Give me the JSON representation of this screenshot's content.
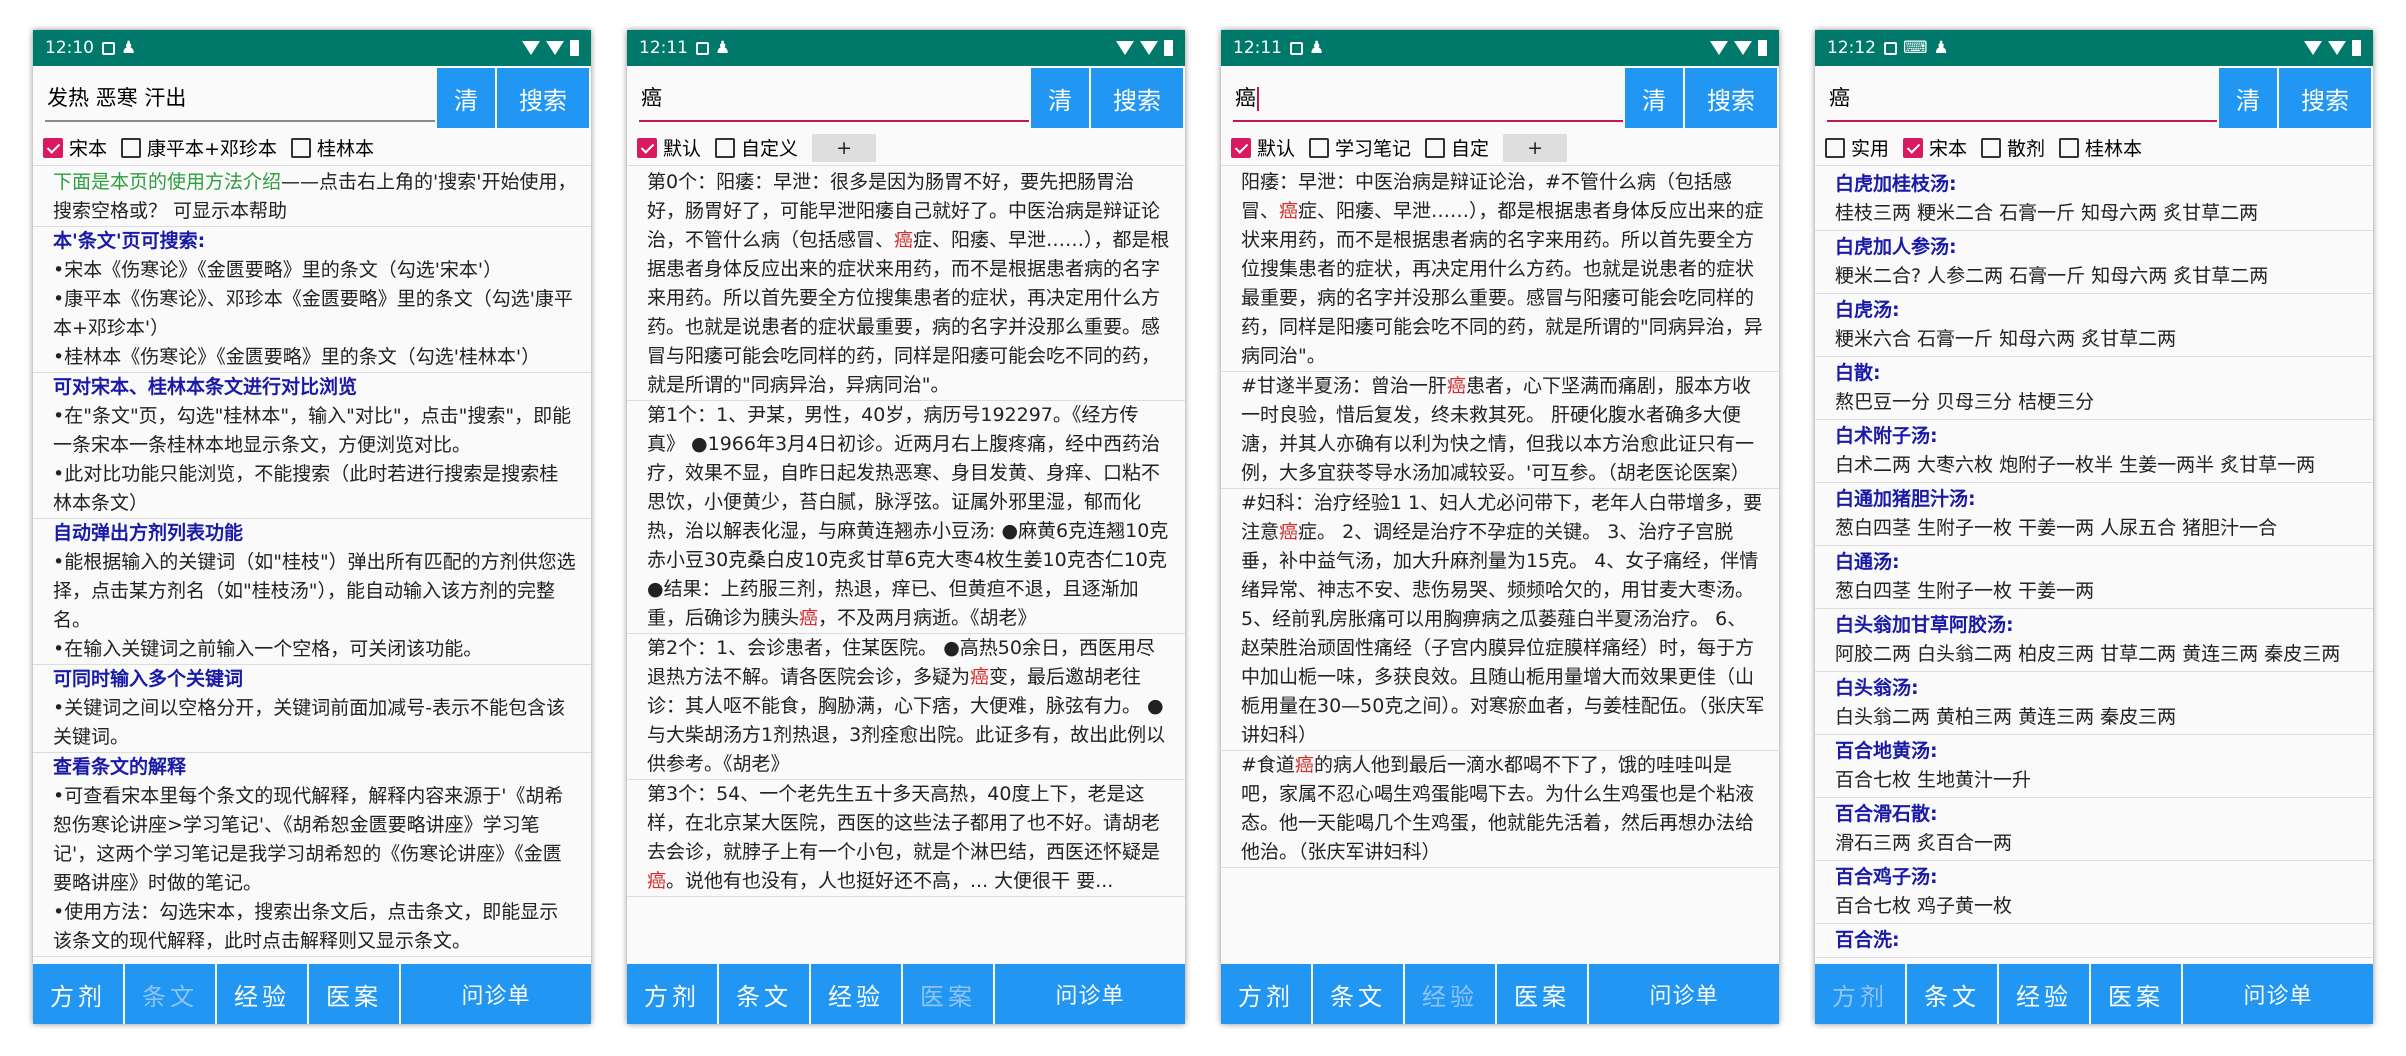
{
  "screens": [
    {
      "status_time": "12:10",
      "search_value": "发热 恶寒 汗出",
      "clear_label": "清",
      "search_label": "搜索",
      "checks": [
        {
          "label": "宋本",
          "checked": true
        },
        {
          "label": "康平本+邓珍本",
          "checked": false
        },
        {
          "label": "桂林本",
          "checked": false
        }
      ],
      "help": {
        "intro_green": "下面是本页的使用方法介绍",
        "intro_rest": "——点击右上角的'搜索'开始使用，搜索空格或？ 可显示本帮助",
        "s1_title": "本'条文'页可搜索:",
        "s1_lines": [
          "•宋本《伤寒论》《金匮要略》里的条文（勾选'宋本'）",
          "•康平本《伤寒论》、邓珍本《金匮要略》里的条文（勾选'康平本+邓珍本'）",
          "•桂林本《伤寒论》《金匮要略》里的条文（勾选'桂林本'）"
        ],
        "s2_title": "可对宋本、桂林本条文进行对比浏览",
        "s2_lines": [
          "•在\"条文\"页，勾选\"桂林本\"，输入\"对比\"，点击\"搜索\"，即能一条宋本一条桂林本地显示条文，方便浏览对比。",
          "•此对比功能只能浏览，不能搜索（此时若进行搜索是搜索桂林本条文）"
        ],
        "s3_title": "自动弹出方剂列表功能",
        "s3_lines": [
          "•能根据输入的关键词（如\"桂枝\"）弹出所有匹配的方剂供您选择，点击某方剂名（如\"桂枝汤\"），能自动输入该方剂的完整名。",
          "•在输入关键词之前输入一个空格，可关闭该功能。"
        ],
        "s4_title": "可同时输入多个关键词",
        "s4_lines": [
          "•关键词之间以空格分开，关键词前面加减号-表示不能包含该关键词。"
        ],
        "s5_title": "查看条文的解释",
        "s5_lines": [
          "•可查看宋本里每个条文的现代解释，解释内容来源于'《胡希恕伤寒论讲座>学习笔记'、《胡希恕金匮要略讲座》学习笔记'，这两个学习笔记是我学习胡希恕的《伤寒论讲座》《金匮要略讲座》时做的笔记。",
          "•使用方法：勾选宋本，搜索出条文后，点击条文，即能显示该条文的现代解释，此时点击解释则又显示条文。"
        ]
      },
      "tabs": [
        {
          "label": "方剂",
          "dim": false
        },
        {
          "label": "条文",
          "dim": true
        },
        {
          "label": "经验",
          "dim": false
        },
        {
          "label": "医案",
          "dim": false
        },
        {
          "label": "问诊单",
          "dim": false
        }
      ]
    },
    {
      "status_time": "12:11",
      "search_value": "癌",
      "clear_label": "清",
      "search_label": "搜索",
      "checks": [
        {
          "label": "默认",
          "checked": true
        },
        {
          "label": "自定义",
          "checked": false
        }
      ],
      "plus_label": "+",
      "entries": [
        [
          "第0个：阳痿：早泄：很多是因为肠胃不好，要先把肠胃治好，肠胃好了，可能早泄阳痿自己就好了。中医治病是辩证论治，不管什么病（包括感冒、",
          "癌",
          "症、阳痿、早泄……），都是根据患者身体反应出来的症状来用药，而不是根据患者病的名字来用药。所以首先要全方位搜集患者的症状，再决定用什么方药。也就是说患者的症状最重要，病的名字并没那么重要。感冒与阳痿可能会吃同样的药，同样是阳痿可能会吃不同的药，就是所谓的\"同病异治，异病同治\"。"
        ],
        [
          "第1个：1、尹某，男性，40岁，病历号192297。《经方传真》 ●1966年3月4日初诊。近两月右上腹疼痛，经中西药治疗，效果不显，自昨日起发热恶寒、身目发黄、身痒、口粘不思饮，小便黄少，苔白腻，脉浮弦。证属外邪里湿，郁而化热，治以解表化湿，与麻黄连翘赤小豆汤: ●麻黄6克连翘10克赤小豆30克桑白皮10克炙甘草6克大枣4枚生姜10克杏仁10克 ●结果：上药服三剂，热退，痒已、但黄疸不退，且逐渐加重，后确诊为胰头",
          "癌",
          "，不及两月病逝。《胡老》"
        ],
        [
          "第2个：1、会诊患者，住某医院。 ●高热50余日，西医用尽退热方法不解。请各医院会诊，多疑为",
          "癌",
          "变，最后邀胡老往诊：其人呕不能食，胸胁满，心下痞，大便难，脉弦有力。 ●与大柴胡汤方1剂热退，3剂痊愈出院。此证多有，故出此例以供参考。《胡老》"
        ],
        [
          "第3个：54、一个老先生五十多天高热，40度上下，老是这样，在北京某大医院，西医的这些法子都用了也不好。请胡老去会诊，就脖子上有一个小包，就是个淋巴结，西医还怀疑是",
          "癌",
          "。说他有也没有，人也挺好还不高，... 大便很干 要..."
        ]
      ],
      "tabs": [
        {
          "label": "方剂",
          "dim": false
        },
        {
          "label": "条文",
          "dim": false
        },
        {
          "label": "经验",
          "dim": false
        },
        {
          "label": "医案",
          "dim": true
        },
        {
          "label": "问诊单",
          "dim": false
        }
      ]
    },
    {
      "status_time": "12:11",
      "search_value": "癌",
      "clear_label": "清",
      "search_label": "搜索",
      "checks": [
        {
          "label": "默认",
          "checked": true
        },
        {
          "label": "学习笔记",
          "checked": false
        },
        {
          "label": "自定",
          "checked": false
        }
      ],
      "plus_label": "+",
      "entries": [
        [
          "阳痿：早泄：中医治病是辩证论治，#不管什么病（包括感冒、",
          "癌",
          "症、阳痿、早泄……），都是根据患者身体反应出来的症状来用药，而不是根据患者病的名字来用药。所以首先要全方位搜集患者的症状，再决定用什么方药。也就是说患者的症状最重要，病的名字并没那么重要。感冒与阳痿可能会吃同样的药，同样是阳痿可能会吃不同的药，就是所谓的\"同病异治，异病同治\"。"
        ],
        [
          "#甘遂半夏汤：曾治一肝",
          "癌",
          "患者，心下坚满而痛剧，服本方收一时良验，惜后复发，终未救其死。 肝硬化腹水者确多大便溏，并其人亦确有以利为快之情，但我以本方治愈此证只有一例，大多宜获苓导水汤加减较妥。'可互参。（胡老医论医案）"
        ],
        [
          "#妇科：治疗经验1 1、妇人尤必问带下，老年人白带增多，要注意",
          "癌",
          "症。 2、调经是治疗不孕症的关键。 3、治疗子宫脱垂，补中益气汤，加大升麻剂量为15克。 4、女子痛经，伴情绪异常、神志不安、悲伤易哭、频频哈欠的，用甘麦大枣汤。 5、经前乳房胀痛可以用胸痹病之瓜蒌薤白半夏汤治疗。 6、赵荣胜治顽固性痛经（子宫内膜异位症膜样痛经）时，每于方中加山栀一味，多获良效。且随山栀用量增大而效果更佳（山栀用量在30—50克之间）。对寒瘀血者，与姜桂配伍。（张庆军讲妇科）"
        ],
        [
          "#食道",
          "癌",
          "的病人他到最后一滴水都喝不下了，饿的哇哇叫是吧，家属不忍心喝生鸡蛋能喝下去。为什么生鸡蛋也是个粘液态。他一天能喝几个生鸡蛋，他就能先活着，然后再想办法给他治。（张庆军讲妇科）"
        ]
      ],
      "tabs": [
        {
          "label": "方剂",
          "dim": false
        },
        {
          "label": "条文",
          "dim": false
        },
        {
          "label": "经验",
          "dim": true
        },
        {
          "label": "医案",
          "dim": false
        },
        {
          "label": "问诊单",
          "dim": false
        }
      ]
    },
    {
      "status_time": "12:12",
      "search_value": "癌",
      "clear_label": "清",
      "search_label": "搜索",
      "checks": [
        {
          "label": "实用",
          "checked": false
        },
        {
          "label": "宋本",
          "checked": true
        },
        {
          "label": "散剂",
          "checked": false
        },
        {
          "label": "桂林本",
          "checked": false
        }
      ],
      "formulas": [
        {
          "name": "白虎加桂枝汤:",
          "rx": "桂枝三两 粳米二合 石膏一斤 知母六两 炙甘草二两"
        },
        {
          "name": "白虎加人参汤:",
          "rx": "粳米二合? 人参二两 石膏一斤 知母六两 炙甘草二两"
        },
        {
          "name": "白虎汤:",
          "rx": "粳米六合 石膏一斤 知母六两 炙甘草二两"
        },
        {
          "name": "白散:",
          "rx": "熬巴豆一分 贝母三分 桔梗三分"
        },
        {
          "name": "白术附子汤:",
          "rx": "白术二两 大枣六枚 炮附子一枚半 生姜一两半 炙甘草一两"
        },
        {
          "name": "白通加猪胆汁汤:",
          "rx": "葱白四茎 生附子一枚 干姜一两 人尿五合 猪胆汁一合"
        },
        {
          "name": "白通汤:",
          "rx": "葱白四茎 生附子一枚 干姜一两"
        },
        {
          "name": "白头翁加甘草阿胶汤:",
          "rx": "阿胶二两 白头翁二两 柏皮三两 甘草二两 黄连三两 秦皮三两"
        },
        {
          "name": "白头翁汤:",
          "rx": "白头翁二两 黄柏三两 黄连三两 秦皮三两"
        },
        {
          "name": "百合地黄汤:",
          "rx": "百合七枚 生地黄汁一升"
        },
        {
          "name": "百合滑石散:",
          "rx": "滑石三两 炙百合一两"
        },
        {
          "name": "百合鸡子汤:",
          "rx": "百合七枚 鸡子黄一枚"
        },
        {
          "name": "百合洗:",
          "rx": ""
        }
      ],
      "tabs": [
        {
          "label": "方剂",
          "dim": true
        },
        {
          "label": "条文",
          "dim": false
        },
        {
          "label": "经验",
          "dim": false
        },
        {
          "label": "医案",
          "dim": false
        },
        {
          "label": "问诊单",
          "dim": false
        }
      ]
    }
  ]
}
